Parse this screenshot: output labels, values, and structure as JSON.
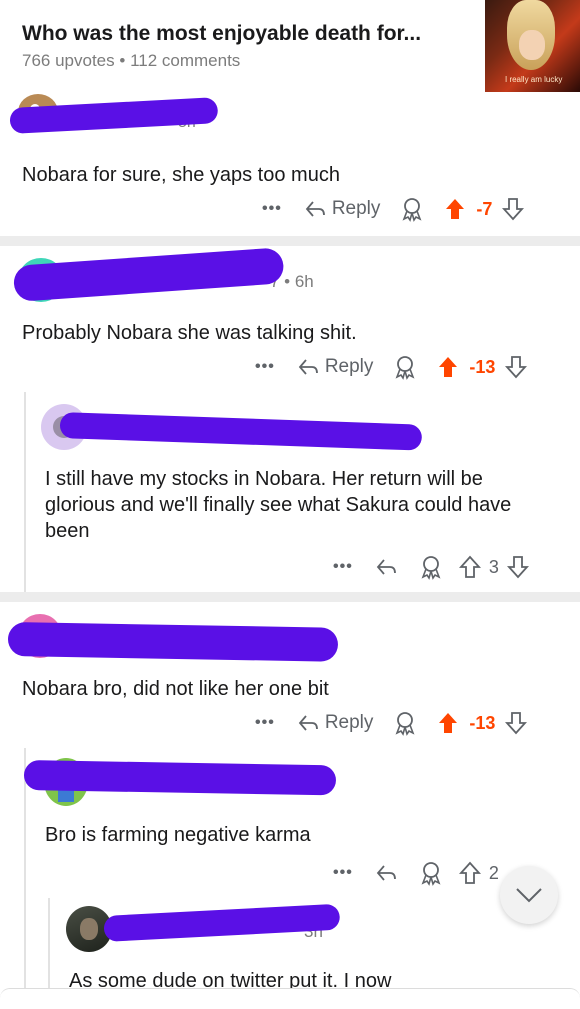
{
  "post": {
    "title": "Who was the most enjoyable death for...",
    "upvotes": "766 upvotes",
    "separator": "•",
    "comments": "112 comments",
    "thumbnail_caption": "I really am lucky"
  },
  "comments": [
    {
      "meta_fragment": "5h",
      "text": "Nobara for sure, she yaps too much",
      "reply_label": "Reply",
      "score": "-7"
    },
    {
      "meta_fragment": "7 • 6h",
      "text": "Probably Nobara she was talking shit.",
      "reply_label": "Reply",
      "score": "-13",
      "replies": [
        {
          "text": "I still have my stocks in Nobara. Her return will be glorious and we'll finally see what Sakura could have been",
          "score": "3"
        }
      ]
    },
    {
      "text": "Nobara bro, did not like her one bit",
      "reply_label": "Reply",
      "score": "-13",
      "replies": [
        {
          "text": "Bro is farming negative karma",
          "score": "2",
          "replies": [
            {
              "meta_fragment": "3h",
              "text": "As some dude on twitter put it. I now"
            }
          ]
        }
      ]
    }
  ],
  "colors": {
    "accent": "#ff4500",
    "redaction": "#5a10e6",
    "muted": "#7c7c7c"
  },
  "icons": [
    "more-icon",
    "reply-arrow-icon",
    "award-icon",
    "upvote-icon",
    "downvote-icon",
    "chevron-down-icon"
  ]
}
